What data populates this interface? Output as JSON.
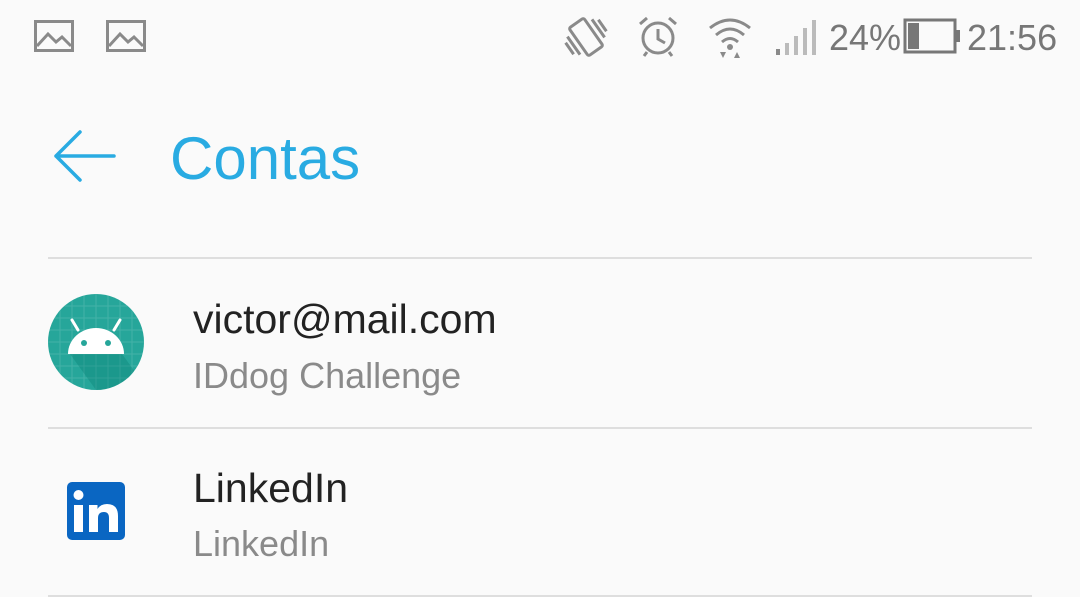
{
  "status_bar": {
    "notifications": [
      "image-icon",
      "image-icon"
    ],
    "battery_percent": "24%",
    "battery_level": 0.24,
    "time": "21:56"
  },
  "toolbar": {
    "title": "Contas"
  },
  "accounts": [
    {
      "title": "victor@mail.com",
      "subtitle": "IDdog Challenge",
      "icon": "android-icon"
    },
    {
      "title": "LinkedIn",
      "subtitle": "LinkedIn",
      "icon": "linkedin-icon"
    }
  ],
  "colors": {
    "accent": "#29abe2",
    "android_bg": "#26a69a",
    "linkedin_blue": "#0a66c2"
  }
}
